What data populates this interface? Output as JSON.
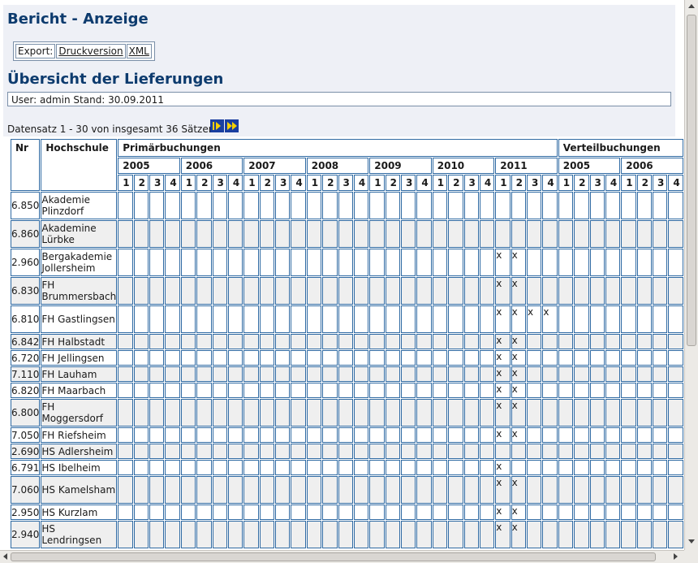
{
  "page": {
    "title": "Bericht - Anzeige",
    "export": {
      "label": "Export:",
      "druck": "Druckversion",
      "xml": "XML"
    },
    "subtitle": "Übersicht der Lieferungen",
    "userline": "User: admin  Stand: 30.09.2011",
    "datasatz": "Datensatz 1 - 30 von insgesamt 36 Sätzen"
  },
  "table": {
    "col_nr": "Nr",
    "col_hochschule": "Hochschule",
    "group_primaer": "Primärbuchungen",
    "group_verteil": "Verteilbuchungen",
    "years_primaer": [
      "2005",
      "2006",
      "2007",
      "2008",
      "2009",
      "2010",
      "2011"
    ],
    "years_verteil": [
      "2005",
      "2006"
    ],
    "quarters": [
      "1",
      "2",
      "3",
      "4"
    ],
    "rows": [
      {
        "nr": "6.850",
        "name": "Akademie Plinzdorf",
        "tall": true,
        "marks": []
      },
      {
        "nr": "6.860",
        "name": "Akademine Lürbke",
        "tall": true,
        "marks": []
      },
      {
        "nr": "2.960",
        "name": "Bergakademie Jollersheim",
        "tall": true,
        "marks": [
          24,
          25
        ]
      },
      {
        "nr": "6.830",
        "name": "FH Brummersbach",
        "tall": true,
        "marks": [
          24,
          25
        ]
      },
      {
        "nr": "6.810",
        "name": "FH Gastlingsen",
        "tall": true,
        "marks": [
          24,
          25,
          26,
          27
        ]
      },
      {
        "nr": "6.842",
        "name": "FH Halbstadt",
        "tall": false,
        "marks": [
          24,
          25
        ]
      },
      {
        "nr": "6.720",
        "name": "FH Jellingsen",
        "tall": false,
        "marks": [
          24,
          25
        ]
      },
      {
        "nr": "7.110",
        "name": "FH Lauham",
        "tall": false,
        "marks": [
          24,
          25
        ]
      },
      {
        "nr": "6.820",
        "name": "FH Maarbach",
        "tall": false,
        "marks": [
          24,
          25
        ]
      },
      {
        "nr": "6.800",
        "name": "FH Moggersdorf",
        "tall": true,
        "marks": [
          24,
          25
        ]
      },
      {
        "nr": "7.050",
        "name": "FH Riefsheim",
        "tall": false,
        "marks": [
          24,
          25
        ]
      },
      {
        "nr": "2.690",
        "name": "HS Adlersheim",
        "tall": false,
        "marks": []
      },
      {
        "nr": "6.791",
        "name": "HS Ibelheim",
        "tall": false,
        "marks": [
          24
        ]
      },
      {
        "nr": "7.060",
        "name": "HS Kamelsham",
        "tall": true,
        "marks": [
          24,
          25
        ]
      },
      {
        "nr": "2.950",
        "name": "HS Kurzlam",
        "tall": false,
        "marks": [
          24,
          25
        ]
      },
      {
        "nr": "2.940",
        "name": "HS Lendringsen",
        "tall": true,
        "marks": [
          24,
          25
        ]
      }
    ],
    "mark": "x"
  }
}
